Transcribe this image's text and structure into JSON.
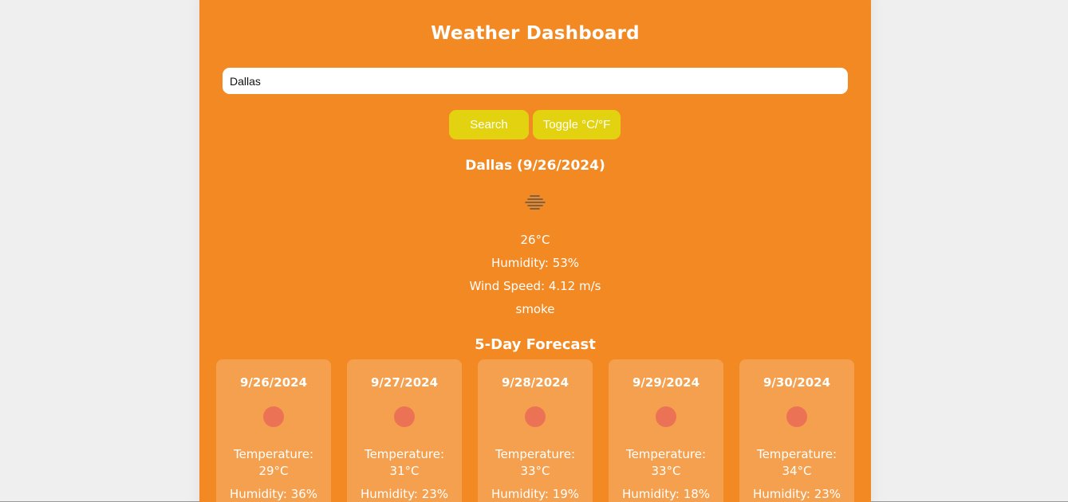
{
  "header": {
    "title": "Weather Dashboard"
  },
  "search": {
    "value": "Dallas"
  },
  "buttons": {
    "search_label": "Search",
    "toggle_label": "Toggle °C/°F"
  },
  "current": {
    "title": "Dallas (9/26/2024)",
    "icon": "smoke-icon",
    "temperature": "26°C",
    "humidity": "Humidity: 53%",
    "wind": "Wind Speed: 4.12 m/s",
    "description": "smoke"
  },
  "forecast": {
    "title": "5-Day Forecast",
    "days": [
      {
        "date": "9/26/2024",
        "icon": "sun-icon",
        "temp_label": "Temperature:",
        "temp": "29°C",
        "humidity": "Humidity: 36%"
      },
      {
        "date": "9/27/2024",
        "icon": "sun-icon",
        "temp_label": "Temperature:",
        "temp": "31°C",
        "humidity": "Humidity: 23%"
      },
      {
        "date": "9/28/2024",
        "icon": "sun-icon",
        "temp_label": "Temperature:",
        "temp": "33°C",
        "humidity": "Humidity: 19%"
      },
      {
        "date": "9/29/2024",
        "icon": "sun-icon",
        "temp_label": "Temperature:",
        "temp": "33°C",
        "humidity": "Humidity: 18%"
      },
      {
        "date": "9/30/2024",
        "icon": "sun-icon",
        "temp_label": "Temperature:",
        "temp": "34°C",
        "humidity": "Humidity: 23%"
      }
    ]
  },
  "colors": {
    "background": "#efefef",
    "panel": "#f28923",
    "button": "#e2d20f",
    "card": "#f4a04e",
    "sun": "#ec7255"
  }
}
